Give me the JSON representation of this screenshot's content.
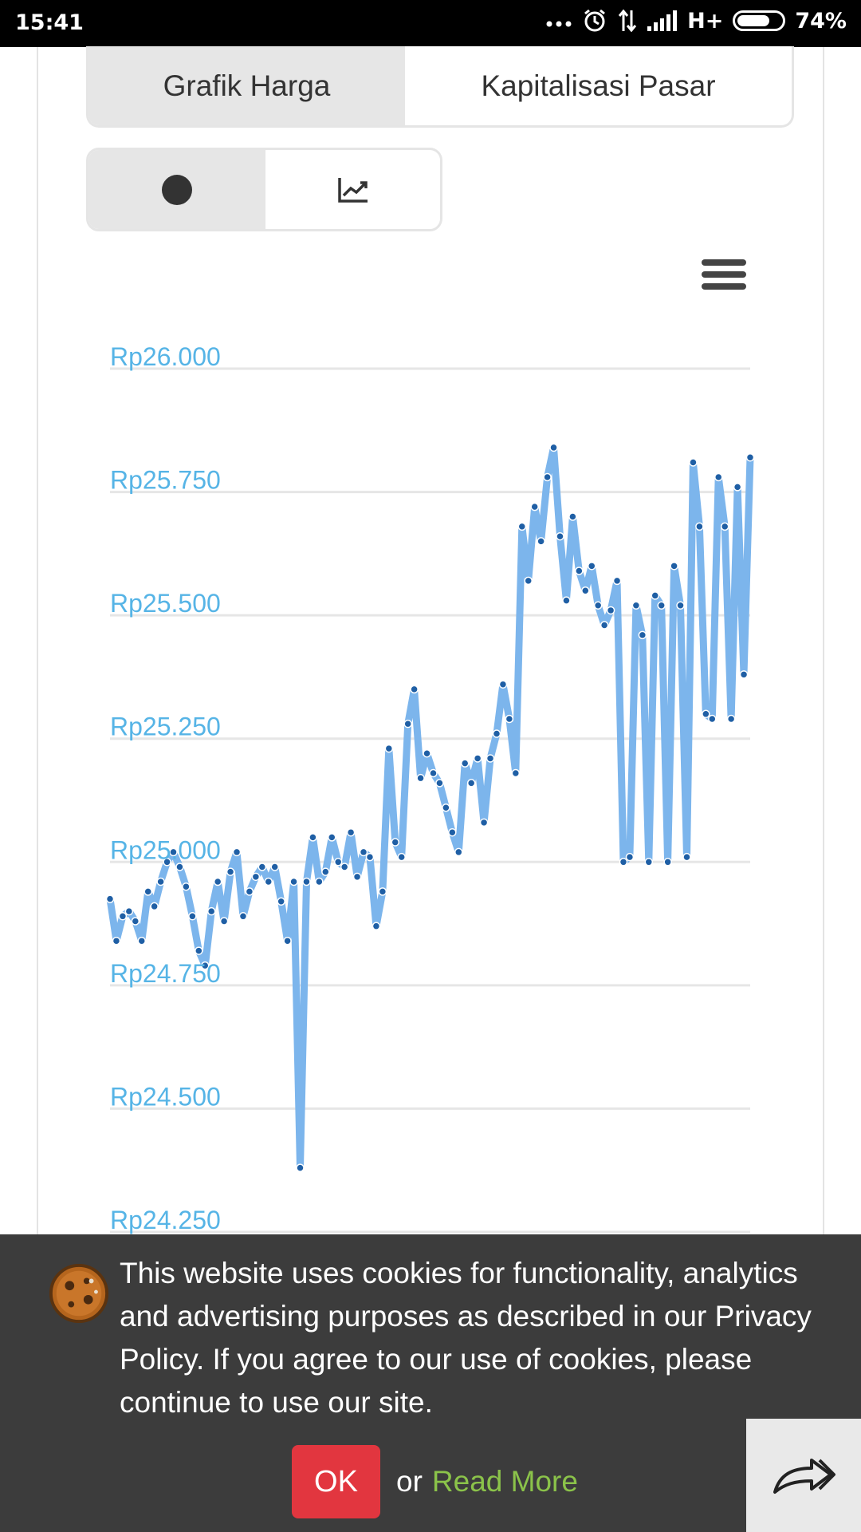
{
  "status_bar": {
    "time": "15:41",
    "network": "H+",
    "battery": "74%",
    "battery_level": 0.74,
    "icons": [
      "more-icon",
      "alarm-icon",
      "data-transfer-icon",
      "signal-icon",
      "battery-icon"
    ]
  },
  "tabs": [
    {
      "label": "Grafik Harga",
      "active": true
    },
    {
      "label": "Kapitalisasi Pasar",
      "active": false
    }
  ],
  "chart_modes": [
    {
      "icon": "dot-icon",
      "active": true
    },
    {
      "icon": "line-chart-icon",
      "active": false
    }
  ],
  "chart_menu_icon": "hamburger-menu-icon",
  "chart_data": {
    "type": "area",
    "title": "",
    "xlabel": "",
    "ylabel": "",
    "ylim": [
      24250,
      26000
    ],
    "yticks": [
      26000,
      25750,
      25500,
      25250,
      25000,
      24750,
      24500,
      24250
    ],
    "ytick_labels": [
      "Rp26.000",
      "Rp25.750",
      "Rp25.500",
      "Rp25.250",
      "Rp25.000",
      "Rp24.750",
      "Rp24.500",
      "Rp24.250"
    ],
    "grid": true,
    "colors": {
      "area": "#7cb5ec",
      "point": "#1f5fa5",
      "tick_label": "#56b4e6"
    },
    "series": [
      {
        "values": [
          24925,
          24840,
          24890,
          24900,
          24880,
          24840,
          24940,
          24910,
          24960,
          25000,
          25020,
          24990,
          24950,
          24890,
          24820,
          24790,
          24900,
          24960,
          24880,
          24980,
          25020,
          24890,
          24940,
          24970,
          24990,
          24960,
          24990,
          24920,
          24840,
          24960,
          24380,
          24960,
          25050,
          24960,
          24980,
          25050,
          25000,
          24990,
          25060,
          24970,
          25020,
          25010,
          24870,
          24940,
          25230,
          25040,
          25010,
          25280,
          25350,
          25170,
          25220,
          25180,
          25160,
          25110,
          25060,
          25020,
          25200,
          25160,
          25210,
          25080,
          25210,
          25260,
          25360,
          25290,
          25180,
          25680,
          25570,
          25720,
          25650,
          25780,
          25840,
          25660,
          25530,
          25700,
          25590,
          25550,
          25600,
          25520,
          25480,
          25510,
          25570,
          25000,
          25010,
          25520,
          25460,
          25000,
          25540,
          25520,
          25000,
          25600,
          25520,
          25010,
          25810,
          25680,
          25300,
          25290,
          25780,
          25680,
          25290,
          25760,
          25380,
          25820
        ],
        "x_span": [
          0,
          101
        ]
      }
    ]
  },
  "cookie_banner": {
    "icon": "cookie-icon",
    "message": "This website uses cookies for functionality, analytics and advertising purposes as described in our Privacy Policy. If you agree to our use of cookies, please continue to use our site.",
    "ok_label": "OK",
    "or_text": "or",
    "read_more_label": "Read More"
  },
  "share_icon": "forward-arrow-icon"
}
